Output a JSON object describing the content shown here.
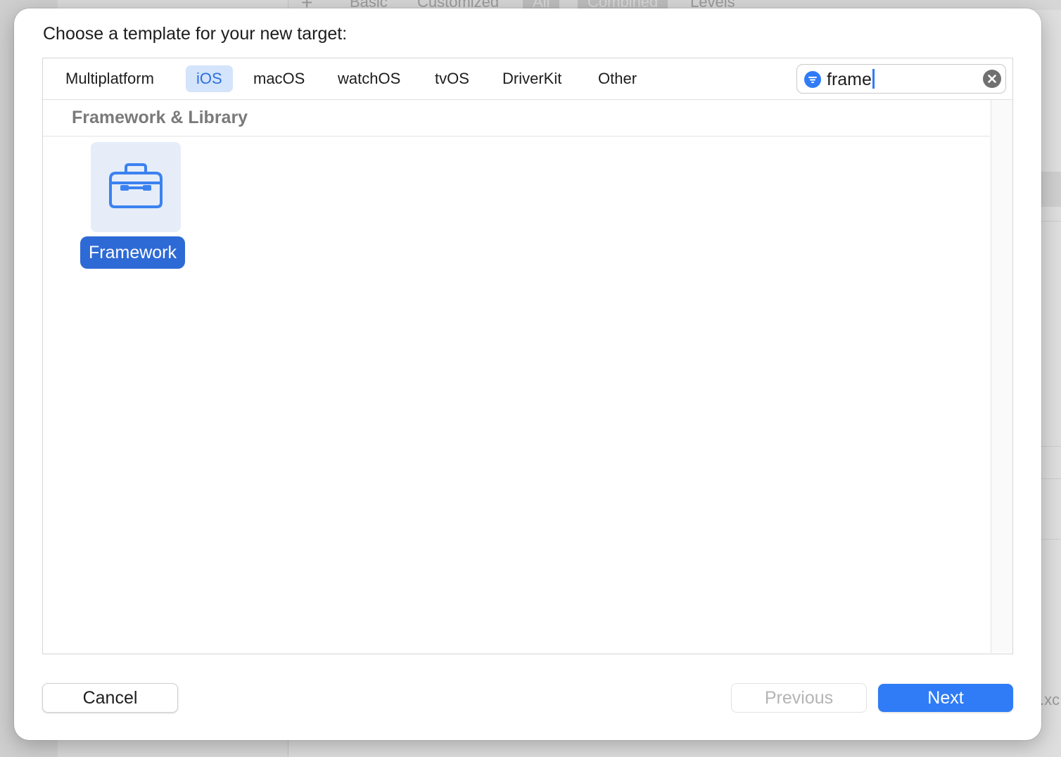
{
  "background": {
    "plus_label": "+",
    "tabs": [
      "Basic",
      "Customized",
      "All",
      "Combined",
      "Levels"
    ],
    "file_suffix": ".xc"
  },
  "dialog": {
    "title": "Choose a template for your new target:",
    "platform_tabs": [
      {
        "label": "Multiplatform",
        "selected": false
      },
      {
        "label": "iOS",
        "selected": true
      },
      {
        "label": "macOS",
        "selected": false
      },
      {
        "label": "watchOS",
        "selected": false
      },
      {
        "label": "tvOS",
        "selected": false
      },
      {
        "label": "DriverKit",
        "selected": false
      },
      {
        "label": "Other",
        "selected": false
      }
    ],
    "search": {
      "value": "frame",
      "filter_icon": "filter-icon",
      "clear_icon": "clear-icon"
    },
    "section_title": "Framework & Library",
    "templates": [
      {
        "label": "Framework",
        "icon": "toolbox-icon",
        "selected": true
      }
    ],
    "buttons": {
      "cancel": "Cancel",
      "previous": "Previous",
      "next": "Next"
    }
  },
  "colors": {
    "accent": "#2f7cf6",
    "selection": "#2e6ad6",
    "tab_selected_bg": "#d3e4fb"
  }
}
